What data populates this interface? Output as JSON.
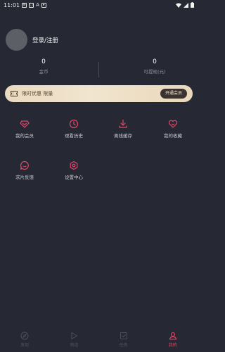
{
  "status_bar": {
    "time": "11:01"
  },
  "profile": {
    "login_label": "登录/注册"
  },
  "stats": [
    {
      "value": "0",
      "label": "金币"
    },
    {
      "value": "0",
      "label": "可提现(元)"
    }
  ],
  "promo": {
    "text": "限时优惠 限量",
    "button": "开通会员"
  },
  "grid": [
    {
      "label": "我的会员",
      "icon": "diamond-icon"
    },
    {
      "label": "观看历史",
      "icon": "clock-icon"
    },
    {
      "label": "离线缓存",
      "icon": "download-icon"
    },
    {
      "label": "我的收藏",
      "icon": "heart-icon"
    },
    {
      "label": "求片反馈",
      "icon": "feedback-icon"
    },
    {
      "label": "设置中心",
      "icon": "gear-icon"
    }
  ],
  "tabs": [
    {
      "label": "发现",
      "icon": "compass-icon",
      "active": false
    },
    {
      "label": "频道",
      "icon": "play-icon",
      "active": false
    },
    {
      "label": "任务",
      "icon": "task-icon",
      "active": false
    },
    {
      "label": "我的",
      "icon": "user-icon",
      "active": true
    }
  ],
  "colors": {
    "accent": "#e4476a",
    "background": "#262834",
    "promo": "#ecdcc2"
  }
}
